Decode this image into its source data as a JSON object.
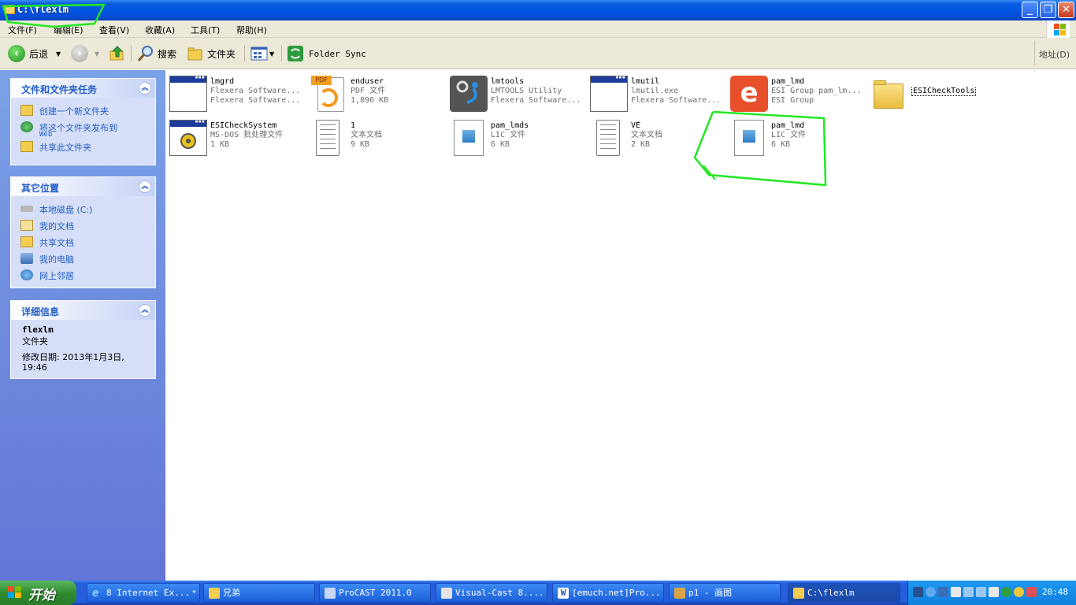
{
  "window": {
    "title": "C:\\flexlm"
  },
  "window_controls": {
    "minimize": "_",
    "restore": "❐",
    "close": "✕"
  },
  "menu": [
    "文件(F)",
    "编辑(E)",
    "查看(V)",
    "收藏(A)",
    "工具(T)",
    "帮助(H)"
  ],
  "toolbar": {
    "back": "后退",
    "search": "搜索",
    "folders": "文件夹",
    "folder_sync": "Folder Sync",
    "address": "地址(D)"
  },
  "sidebar": {
    "tasks": {
      "title": "文件和文件夹任务",
      "items": [
        "创建一个新文件夹",
        "将这个文件夹发布到",
        "共享此文件夹"
      ],
      "web": "Web"
    },
    "places": {
      "title": "其它位置",
      "items": [
        "本地磁盘 (C:)",
        "我的文档",
        "共享文档",
        "我的电脑",
        "网上邻居"
      ]
    },
    "details": {
      "title": "详细信息",
      "name": "flexlm",
      "type": "文件夹",
      "modified": "修改日期: 2013年1月3日, 19:46"
    }
  },
  "files": [
    {
      "name": "lmgrd",
      "line2": "Flexera Software...",
      "line3": "Flexera Software..."
    },
    {
      "name": "enduser",
      "line2": "PDF 文件",
      "line3": "1,896 KB",
      "badge": "PDF"
    },
    {
      "name": "lmtools",
      "line2": "LMTOOLS Utility",
      "line3": "Flexera Software..."
    },
    {
      "name": "lmutil",
      "line2": "lmutil.exe",
      "line3": "Flexera Software..."
    },
    {
      "name": "pam_lmd",
      "line2": "ESI Group pam_lm...",
      "line3": "ESI Group",
      "logo": "e"
    },
    {
      "name": "ESICheckTools",
      "line2": "",
      "line3": ""
    },
    {
      "name": "ESICheckSystem",
      "line2": "MS-DOS 批处理文件",
      "line3": "1 KB"
    },
    {
      "name": "1",
      "line2": "文本文档",
      "line3": "9 KB"
    },
    {
      "name": "pam_lmds",
      "line2": "LIC 文件",
      "line3": "6 KB"
    },
    {
      "name": "VE",
      "line2": "文本文档",
      "line3": "2 KB"
    },
    {
      "name": "pam_lmd",
      "line2": "LIC 文件",
      "line3": "6 KB"
    }
  ],
  "taskbar": {
    "start": "开始",
    "tasks": [
      "8 Internet Ex...",
      "兄弟",
      "ProCAST 2011.0",
      "Visual-Cast 8....",
      "[emuch.net]Pro...",
      "p1 - 画图",
      "C:\\flexlm"
    ],
    "dropdown": "▾",
    "clock": "20:48"
  },
  "colors": {
    "titlebar": "#0054e3",
    "sidebar": "#7ba2e7",
    "panel_head_text": "#215dc6",
    "annotation": "#22e822",
    "start": "#2e8b2e"
  }
}
